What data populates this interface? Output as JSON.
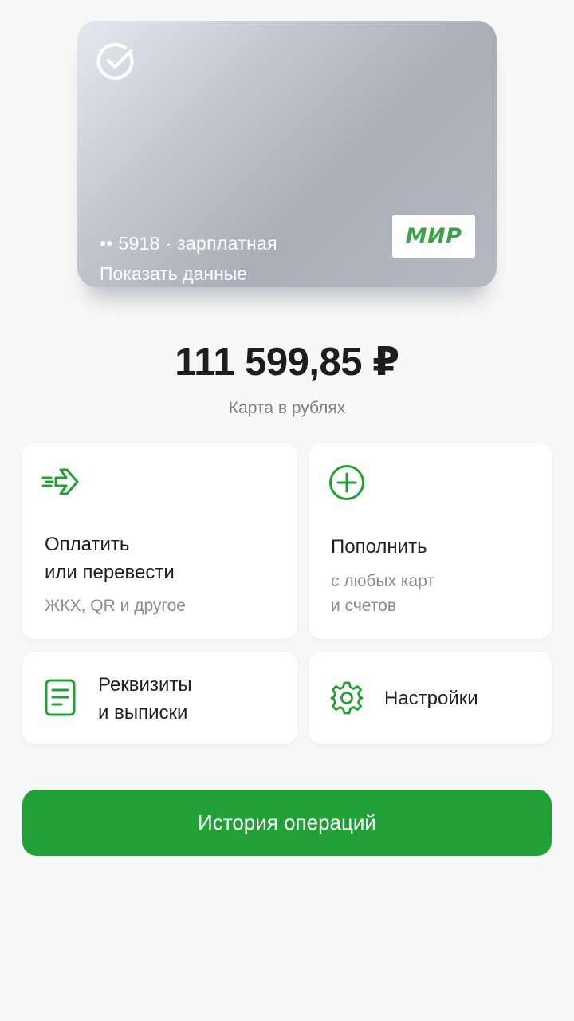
{
  "card": {
    "number_line": "•• 5918 · зарплатная",
    "show_data_label": "Показать данные",
    "payment_system": "МИР"
  },
  "balance": {
    "amount": "111 599,85 ₽",
    "subtitle": "Карта в рублях"
  },
  "tiles": {
    "pay": {
      "title_line1": "Оплатить",
      "title_line2": "или перевести",
      "subtitle": "ЖКХ, QR и другое",
      "icon": "transfer-arrow-icon"
    },
    "topup": {
      "title": "Пополнить",
      "subtitle_line1": "с любых карт",
      "subtitle_line2": "и счетов",
      "icon": "plus-circle-icon"
    },
    "details": {
      "title_line1": "Реквизиты",
      "title_line2": "и выписки",
      "icon": "document-icon"
    },
    "settings": {
      "title": "Настройки",
      "icon": "gear-icon"
    }
  },
  "history_button": {
    "label": "История операций"
  },
  "colors": {
    "accent": "#21a038",
    "background": "#f7f8f8",
    "tile": "#ffffff"
  }
}
